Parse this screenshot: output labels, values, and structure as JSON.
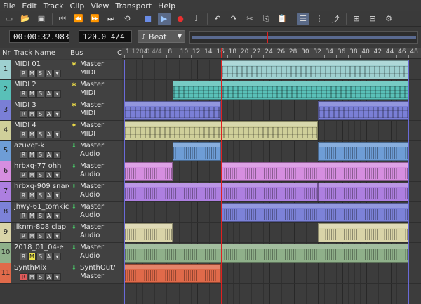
{
  "menu": [
    "File",
    "Edit",
    "Track",
    "Clip",
    "View",
    "Transport",
    "Help"
  ],
  "toolbar": [
    {
      "name": "new-file-icon",
      "glyph": "▭"
    },
    {
      "name": "open-folder-icon",
      "glyph": "📂"
    },
    {
      "name": "save-icon",
      "glyph": "▣"
    },
    {
      "name": "sep"
    },
    {
      "name": "rewind-start-icon",
      "glyph": "⏮"
    },
    {
      "name": "rewind-icon",
      "glyph": "⏪"
    },
    {
      "name": "fast-forward-icon",
      "glyph": "⏩"
    },
    {
      "name": "forward-end-icon",
      "glyph": "⏭"
    },
    {
      "name": "loop-icon",
      "glyph": "⟲"
    },
    {
      "name": "sep"
    },
    {
      "name": "stop-icon",
      "glyph": "■"
    },
    {
      "name": "play-icon",
      "glyph": "▶",
      "active": true
    },
    {
      "name": "record-icon",
      "glyph": "●"
    },
    {
      "name": "metronome-icon",
      "glyph": "♩"
    },
    {
      "name": "sep"
    },
    {
      "name": "undo-icon",
      "glyph": "↶"
    },
    {
      "name": "redo-icon",
      "glyph": "↷"
    },
    {
      "name": "cut-icon",
      "glyph": "✂"
    },
    {
      "name": "copy-icon",
      "glyph": "⎘"
    },
    {
      "name": "paste-icon",
      "glyph": "📋"
    },
    {
      "name": "sep"
    },
    {
      "name": "mixer-icon",
      "glyph": "☰",
      "active": true
    },
    {
      "name": "piano-roll-icon",
      "glyph": "⋮"
    },
    {
      "name": "automation-icon",
      "glyph": "⤴"
    },
    {
      "name": "sep"
    },
    {
      "name": "add-track-icon",
      "glyph": "⊞"
    },
    {
      "name": "delete-track-icon",
      "glyph": "⊟"
    },
    {
      "name": "settings-icon",
      "glyph": "⚙"
    }
  ],
  "transport": {
    "time": "00:00:32.983",
    "tempo": "120.0 4/4",
    "snap": "Beat",
    "snap_icon": "♪"
  },
  "header": {
    "nr": "Nr",
    "name": "Track Name",
    "bus": "Bus",
    "c": "C"
  },
  "ruler": {
    "labels": [
      "1",
      "120.0 4/4",
      "4",
      "8",
      "10",
      "12",
      "14",
      "16",
      "18",
      "20",
      "22",
      "24",
      "26",
      "28",
      "30",
      "32",
      "34",
      "36",
      "38",
      "40",
      "42",
      "44",
      "46",
      "48"
    ],
    "bars": [
      1,
      2,
      4,
      8,
      10,
      12,
      14,
      16,
      18,
      20,
      22,
      24,
      26,
      28,
      30,
      32,
      34,
      36,
      38,
      40,
      42,
      44,
      46,
      48
    ],
    "total_bars": 49,
    "playhead_bar": 17,
    "loop_end_bar": 48
  },
  "tracks": [
    {
      "nr": "1",
      "name": "MIDI 01",
      "bus": "Master MIDI",
      "color": "#9ed0d0",
      "bus_icon": "midi-port-icon",
      "kind": "midi",
      "clips": [
        {
          "start": 17,
          "end": 48
        }
      ]
    },
    {
      "nr": "2",
      "name": "MIDI 2",
      "bus": "Master MIDI",
      "color": "#59c0b8",
      "bus_icon": "midi-port-icon",
      "kind": "midi",
      "clips": [
        {
          "start": 9,
          "end": 48
        }
      ]
    },
    {
      "nr": "3",
      "name": "MIDI 3",
      "bus": "Master MIDI",
      "color": "#7a7fd6",
      "bus_icon": "midi-port-icon",
      "kind": "midi",
      "clips": [
        {
          "start": 1,
          "end": 17
        },
        {
          "start": 33,
          "end": 48
        }
      ]
    },
    {
      "nr": "4",
      "name": "MIDI 4",
      "bus": "Master MIDI",
      "color": "#cfcf9a",
      "bus_icon": "midi-port-icon",
      "kind": "midi",
      "clips": [
        {
          "start": 1,
          "end": 33
        }
      ]
    },
    {
      "nr": "5",
      "name": "azuvqt-k",
      "bus": "Master Audio",
      "color": "#6e9dd6",
      "bus_icon": "audio-port-icon",
      "kind": "audio",
      "clips": [
        {
          "start": 9,
          "end": 17
        },
        {
          "start": 33,
          "end": 48
        }
      ]
    },
    {
      "nr": "6",
      "name": "hrbxq-77 ohh",
      "bus": "Master Audio",
      "color": "#d68ee0",
      "bus_icon": "audio-port-icon",
      "kind": "audio",
      "clips": [
        {
          "start": 1,
          "end": 9
        },
        {
          "start": 17,
          "end": 48
        }
      ]
    },
    {
      "nr": "7",
      "name": "hrbxq-909 snare",
      "bus": "Master Audio",
      "color": "#ad7fe0",
      "bus_icon": "audio-port-icon",
      "kind": "audio",
      "clips": [
        {
          "start": 1,
          "end": 33
        },
        {
          "start": 33,
          "end": 48
        }
      ]
    },
    {
      "nr": "8",
      "name": "jhwy-61_tomkick",
      "bus": "Master Audio",
      "color": "#7c82d8",
      "bus_icon": "audio-port-icon",
      "kind": "audio",
      "clips": [
        {
          "start": 17,
          "end": 48
        }
      ]
    },
    {
      "nr": "9",
      "name": "jlknm-808 clap",
      "bus": "Master Audio",
      "color": "#d9d4a8",
      "bus_icon": "audio-port-icon",
      "kind": "audio",
      "clips": [
        {
          "start": 1,
          "end": 9
        },
        {
          "start": 33,
          "end": 48
        }
      ]
    },
    {
      "nr": "10",
      "name": "2018_01_04-e",
      "bus": "Master Audio",
      "color": "#8fb08a",
      "bus_icon": "audio-port-icon",
      "kind": "audio",
      "mute": true,
      "clips": [
        {
          "start": 1,
          "end": 48
        }
      ]
    },
    {
      "nr": "11",
      "name": "SynthMix",
      "bus": "SynthOut/ Master",
      "color": "#e06a4a",
      "bus_icon": "audio-port-icon",
      "kind": "audio",
      "rec": true,
      "clips": [
        {
          "start": 1,
          "end": 17
        }
      ]
    }
  ],
  "buttons": {
    "r": "R",
    "m": "M",
    "s": "S",
    "a": "A"
  },
  "colors": {
    "playhead": "#e02020",
    "loop": "#6a6ad8"
  }
}
